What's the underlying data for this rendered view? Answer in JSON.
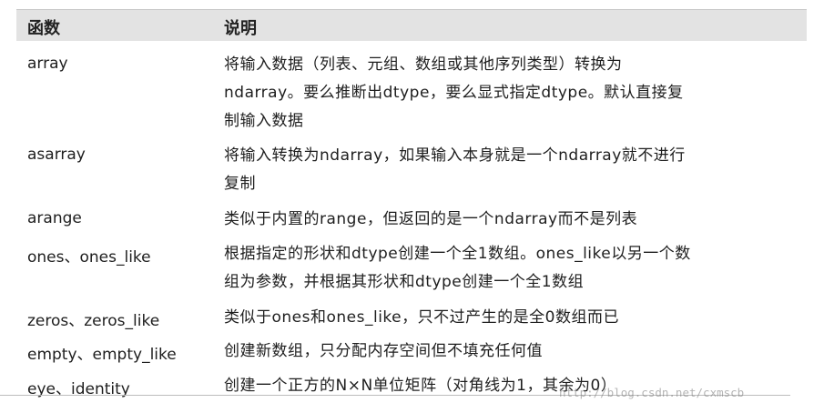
{
  "header": {
    "func": "函数",
    "desc": "说明"
  },
  "rows": [
    {
      "func": "array",
      "lines": [
        "将输入数据（列表、元组、数组或其他序列类型）转换为",
        "ndarray。要么推断出dtype，要么显式指定dtype。默认直接复",
        "制输入数据"
      ]
    },
    {
      "func": "asarray",
      "lines": [
        "将输入转换为ndarray，如果输入本身就是一个ndarray就不进行",
        "复制"
      ]
    },
    {
      "func": "arange",
      "lines": [
        "类似于内置的range，但返回的是一个ndarray而不是列表"
      ]
    },
    {
      "func": "ones、ones_like",
      "lines": [
        "根据指定的形状和dtype创建一个全1数组。ones_like以另一个数",
        "组为参数，并根据其形状和dtype创建一个全1数组"
      ]
    },
    {
      "func": "zeros、zeros_like",
      "lines": [
        "类似于ones和ones_like，只不过产生的是全0数组而已"
      ]
    },
    {
      "func": "empty、empty_like",
      "lines": [
        "创建新数组，只分配内存空间但不填充任何值"
      ]
    },
    {
      "func": "eye、identity",
      "lines": [
        "创建一个正方的N×N单位矩阵（对角线为1，其余为0）"
      ]
    }
  ],
  "watermark": "http://blog.csdn.net/cxmscb"
}
